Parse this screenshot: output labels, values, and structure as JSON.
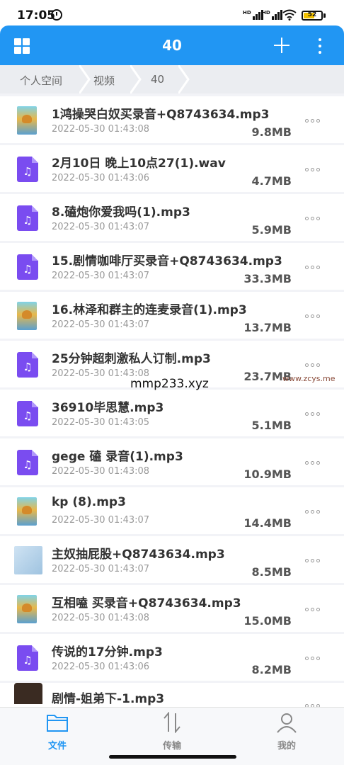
{
  "status_bar": {
    "time": "17:05",
    "hd1": "HD",
    "hd2": "HD",
    "battery": "52"
  },
  "header": {
    "title": "40",
    "grid_icon": "grid-icon",
    "add_icon": "plus-icon",
    "more_icon": "more-vertical-icon",
    "color": "#2196f3"
  },
  "breadcrumb": [
    "个人空间",
    "视频",
    "40"
  ],
  "files": [
    {
      "name": "1鸿操哭白奴买录音+Q8743634.mp3",
      "date": "2022-05-30 01:43:08",
      "size": "9.8MB",
      "icon": "image-thumbnail"
    },
    {
      "name": "2月10日 晚上10点27(1).wav",
      "date": "2022-05-30 01:43:06",
      "size": "4.7MB",
      "icon": "audio-file-icon"
    },
    {
      "name": "8.磕炮你爱我吗(1).mp3",
      "date": "2022-05-30 01:43:07",
      "size": "5.9MB",
      "icon": "audio-file-icon"
    },
    {
      "name": "15.剧情咖啡厅买录音+Q8743634.mp3",
      "date": "2022-05-30 01:43:07",
      "size": "33.3MB",
      "icon": "audio-file-icon"
    },
    {
      "name": "16.林泽和群主的连麦录音(1).mp3",
      "date": "2022-05-30 01:43:07",
      "size": "13.7MB",
      "icon": "image-thumbnail"
    },
    {
      "name": "25分钟超刺激私人订制.mp3",
      "date": "2022-05-30 01:43:08",
      "size": "23.7MB",
      "icon": "audio-file-icon"
    },
    {
      "name": "36910毕思慧.mp3",
      "date": "2022-05-30 01:43:05",
      "size": "5.1MB",
      "icon": "audio-file-icon"
    },
    {
      "name": "gege 磕 录音(1).mp3",
      "date": "2022-05-30 01:43:08",
      "size": "10.9MB",
      "icon": "audio-file-icon"
    },
    {
      "name": "kp (8).mp3",
      "date": "2022-05-30 01:43:07",
      "size": "14.4MB",
      "icon": "image-thumbnail"
    },
    {
      "name": "主奴抽屁股+Q8743634.mp3",
      "date": "2022-05-30 01:43:07",
      "size": "8.5MB",
      "icon": "photo-thumbnail"
    },
    {
      "name": "互相嗑 买录音+Q8743634.mp3",
      "date": "2022-05-30 01:43:08",
      "size": "15.0MB",
      "icon": "image-thumbnail"
    },
    {
      "name": "传说的17分钟.mp3",
      "date": "2022-05-30 01:43:06",
      "size": "8.2MB",
      "icon": "audio-file-icon"
    },
    {
      "name": "剧情-姐弟下-1.mp3",
      "date": "",
      "size": "",
      "icon": "face-thumbnail"
    }
  ],
  "watermarks": {
    "center": "mmp233.xyz",
    "right": "www.zcys.me"
  },
  "bottom_nav": [
    {
      "label": "文件",
      "icon": "folder-icon",
      "active": true
    },
    {
      "label": "传输",
      "icon": "transfer-arrows-icon",
      "active": false
    },
    {
      "label": "我的",
      "icon": "person-icon",
      "active": false
    }
  ],
  "colors": {
    "accent": "#2196f3",
    "audio_icon": "#7a4cf0",
    "active_nav": "#2196f3",
    "inactive_nav": "#888888"
  }
}
